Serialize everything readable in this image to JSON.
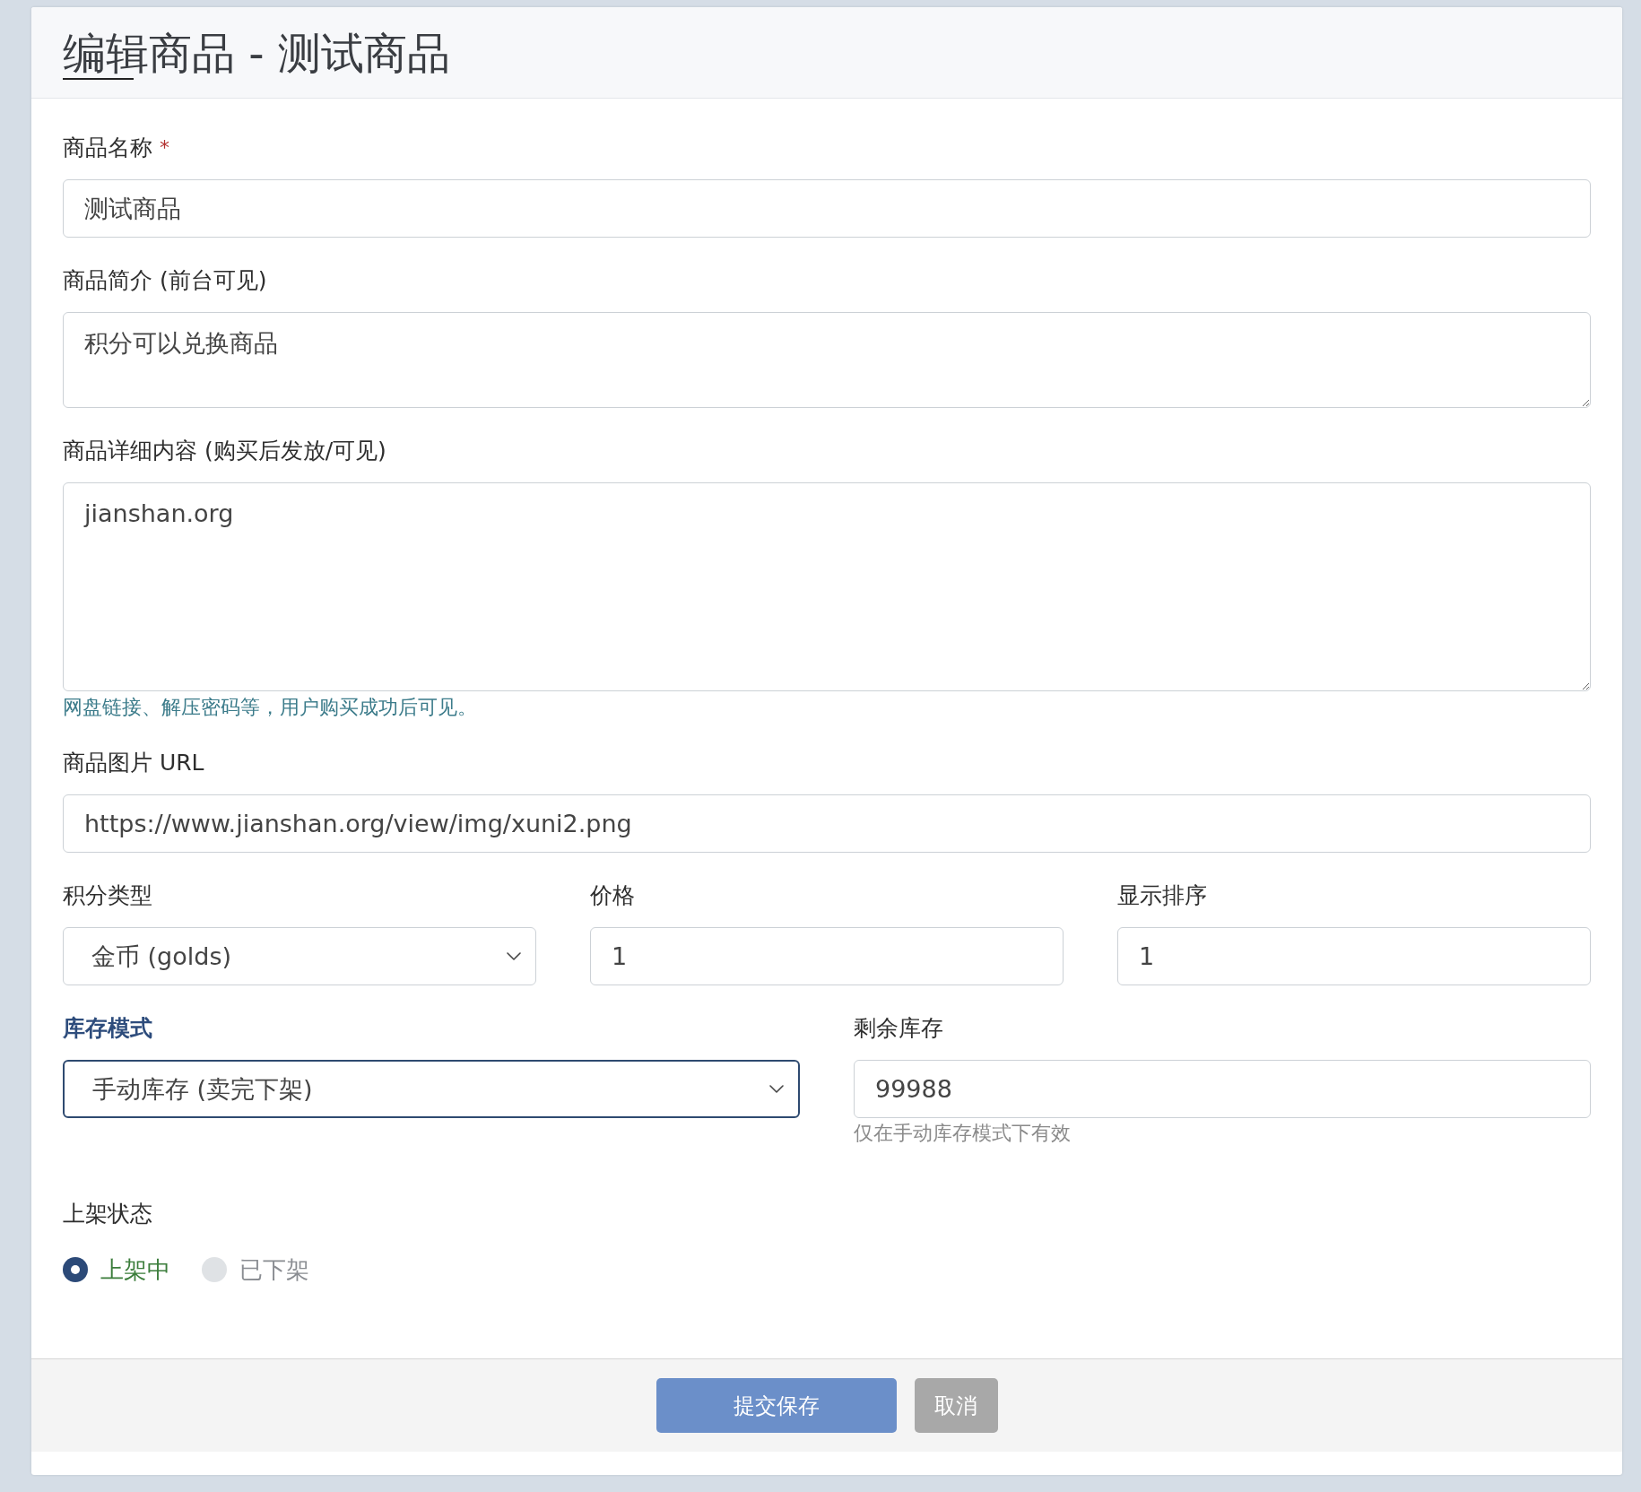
{
  "header": {
    "title": "编辑商品 - 测试商品"
  },
  "form": {
    "fields": [
      {
        "kind": "input",
        "label": "商品名称",
        "required_mark": "*",
        "value": "测试商品"
      },
      {
        "kind": "textarea",
        "label": "商品简介 (前台可见)",
        "value": "积分可以兑换商品"
      },
      {
        "kind": "textarea",
        "label": "商品详细内容 (购买后发放/可见)",
        "value": "jianshan.org",
        "help": {
          "kind": "info",
          "text": "网盘链接、解压密码等，用户购买成功后可见。"
        }
      },
      {
        "kind": "input",
        "label": "商品图片 URL",
        "value": "https://www.jianshan.org/view/img/xuni2.png"
      }
    ],
    "row_1": [
      {
        "kind": "select",
        "label": "积分类型",
        "value": "金币 (golds)"
      },
      {
        "kind": "input",
        "label": "价格",
        "value": "1"
      },
      {
        "kind": "input",
        "label": "显示排序",
        "value": "1"
      }
    ],
    "row_2": [
      {
        "kind": "select",
        "label": "库存模式",
        "value": "手动库存 (卖完下架)",
        "focused": true
      },
      {
        "kind": "input",
        "label": "剩余库存",
        "value": "99988",
        "focused": false,
        "help": {
          "kind": "muted",
          "text": "仅在手动库存模式下有效"
        }
      }
    ],
    "status": {
      "label": "上架状态",
      "options": [
        {
          "label": "上架中",
          "selected": true
        },
        {
          "label": "已下架",
          "selected": false
        }
      ]
    }
  },
  "footer": {
    "buttons": [
      {
        "kind": "primary",
        "label": "提交保存"
      },
      {
        "kind": "secondary",
        "label": "取消"
      }
    ]
  }
}
